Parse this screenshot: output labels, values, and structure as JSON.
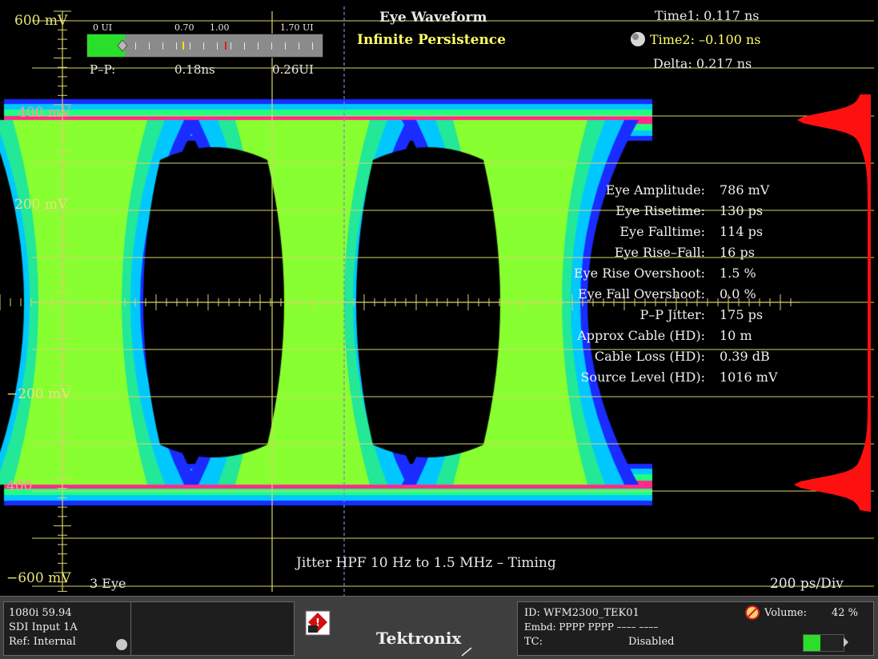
{
  "scale": {
    "top": "600 mV",
    "upper": "200 mV",
    "lower": "−200 mV",
    "bottom": "−600 mV",
    "upper_edge": "400 mV",
    "lower_edge": "400"
  },
  "ruler": {
    "labels": [
      "0 UI",
      "0.70",
      "1.00",
      "1.70 UI"
    ],
    "pp_label": "P–P:",
    "pp_ns": "0.18ns",
    "pp_ui": "0.26UI",
    "fill_fraction": 0.16
  },
  "header": {
    "title": "Eye Waveform",
    "subtitle": "Infinite Persistence"
  },
  "cursors": {
    "time1": "Time1:  0.117 ns",
    "time2": "Time2:  –0.100 ns",
    "delta": "Delta:  0.217 ns"
  },
  "measurements": [
    {
      "label": "Eye Amplitude:",
      "value": "786 mV"
    },
    {
      "label": "Eye Risetime:",
      "value": "130 ps"
    },
    {
      "label": "Eye Falltime:",
      "value": "114 ps"
    },
    {
      "label": "Eye Rise–Fall:",
      "value": "16 ps"
    },
    {
      "label": "Eye Rise Overshoot:",
      "value": "1.5 %"
    },
    {
      "label": "Eye Fall Overshoot:",
      "value": "0.0 %"
    },
    {
      "label": "P–P Jitter:",
      "value": "175 ps"
    },
    {
      "label": "Approx Cable (HD):",
      "value": "10 m"
    },
    {
      "label": "Cable Loss (HD):",
      "value": "0.39 dB"
    },
    {
      "label": "Source Level (HD):",
      "value": "1016 mV"
    }
  ],
  "footer": {
    "jitter_filter": "Jitter HPF 10 Hz to 1.5 MHz – Timing",
    "eye_mode": "3 Eye",
    "timebase": "200 ps/Div"
  },
  "status": {
    "format": "1080i 59.94",
    "input": "SDI Input 1A",
    "ref": "Ref: Internal",
    "brand": "Tektronix",
    "id": "ID: WFM2300_TEK01",
    "embd": "Embd: PPPP PPPP –––– ––––",
    "tc_label": "TC:",
    "tc_value": "Disabled",
    "volume_label": "Volume:",
    "volume_value": "42 %",
    "volume_fraction": 0.42
  },
  "colors": {
    "graticule": "#d8d36a",
    "histogram": "#ff1010",
    "ruler_fill": "#2adf2a",
    "cursor_text": "#ffff66"
  },
  "icons": {
    "cursor_knob": "knob-icon",
    "alarm": "warning-icon",
    "mute": "speaker-mute-icon",
    "battery": "volume-bar-icon"
  }
}
